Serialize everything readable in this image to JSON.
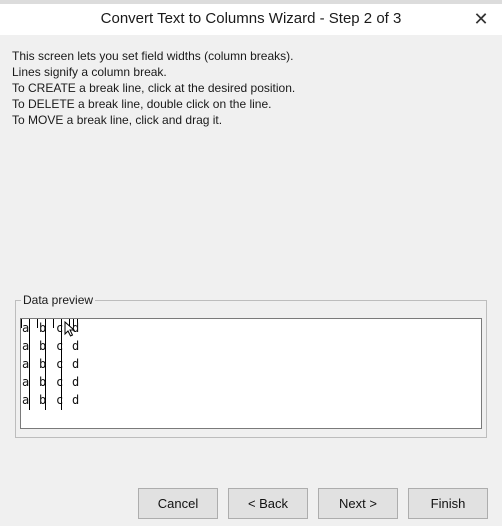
{
  "window": {
    "title": "Convert Text to Columns Wizard - Step 2 of 3",
    "close_glyph": "✕"
  },
  "instructions": [
    "This screen lets you set field widths (column breaks).",
    "Lines signify a column break.",
    "To CREATE a break line, click at the desired position.",
    "To DELETE a break line, double click on the line.",
    "To MOVE a break line, click and drag it."
  ],
  "preview": {
    "label": "Data preview",
    "rows": [
      [
        "a",
        "b",
        "c",
        "d"
      ],
      [
        "a",
        "b",
        "c",
        "d"
      ],
      [
        "a",
        "b",
        "c",
        "d"
      ],
      [
        "a",
        "b",
        "c",
        "d"
      ],
      [
        "a",
        "b",
        "c",
        "d"
      ]
    ]
  },
  "buttons": {
    "cancel": "Cancel",
    "back": "< Back",
    "next": "Next >",
    "finish": "Finish"
  },
  "icons": {
    "close": "close-icon",
    "cursor": "arrow-cursor-icon"
  }
}
